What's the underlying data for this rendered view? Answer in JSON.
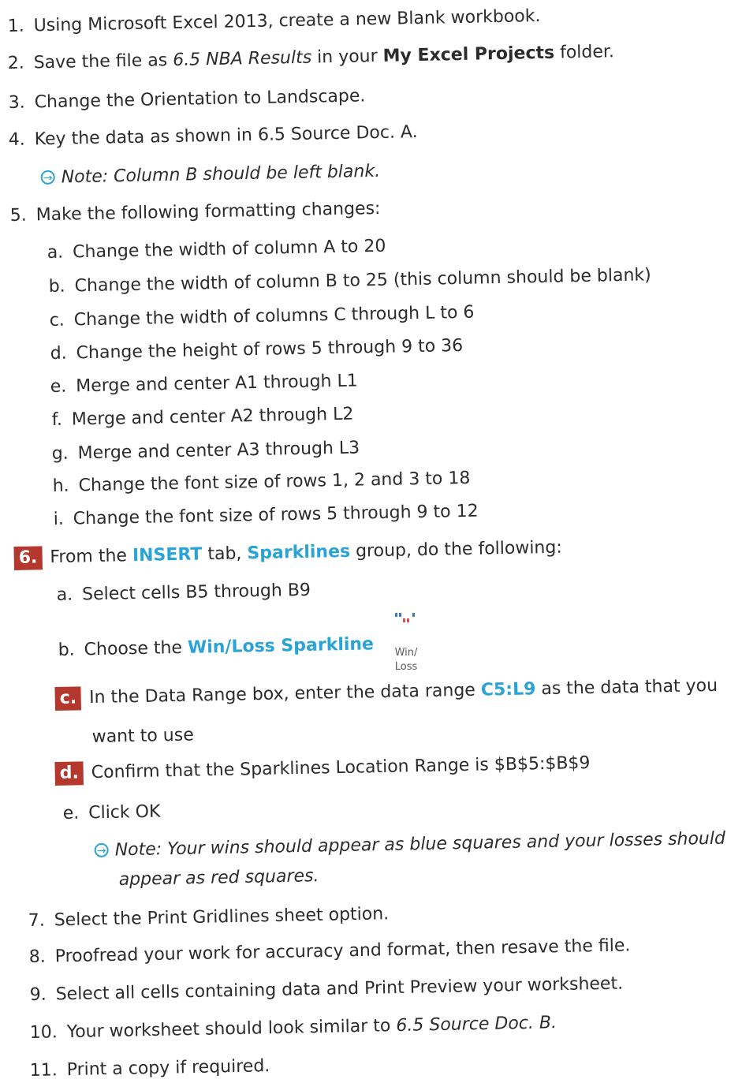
{
  "steps": [
    {
      "num": "1.",
      "text": "Using Microsoft Excel 2013, create a new Blank workbook."
    },
    {
      "num": "2.",
      "pre": "Save the file as ",
      "italic": "6.5 NBA Results",
      "mid": " in your ",
      "bold": "My Excel Projects",
      "post": " folder."
    },
    {
      "num": "3.",
      "text": "Change the Orientation to Landscape."
    },
    {
      "num": "4.",
      "text": "Key the data as shown in 6.5 Source Doc. A."
    },
    {
      "note": "Note: Column B should be left blank."
    },
    {
      "num": "5.",
      "text": "Make the following formatting changes:"
    },
    {
      "num": "a.",
      "text": "Change the width of column A to 20"
    },
    {
      "num": "b.",
      "text": "Change the width of column B to 25 (this column should be blank)"
    },
    {
      "num": "c.",
      "text": "Change the width of columns C through L to 6"
    },
    {
      "num": "d.",
      "text": "Change the height of rows 5 through 9 to 36"
    },
    {
      "num": "e.",
      "text": "Merge and center A1 through L1"
    },
    {
      "num": "f.",
      "text": "Merge and center A2 through L2"
    },
    {
      "num": "g.",
      "text": "Merge and center A3 through L3"
    },
    {
      "num": "h.",
      "text": "Change the font size of rows 1, 2 and 3 to 18"
    },
    {
      "num": "i.",
      "text": "Change the font size of rows 5 through 9 to 12"
    },
    {
      "num": "6.",
      "pre": "From the ",
      "blue1": "INSERT",
      "mid": " tab, ",
      "blue2": "Sparklines",
      "post": " group, do the following:"
    },
    {
      "num": "a.",
      "text": "Select cells B5 through B9"
    },
    {
      "num": "b.",
      "pre": "Choose the ",
      "blue1": "Win/Loss Sparkline"
    },
    {
      "num": "c.",
      "pre": "In the Data Range box, enter the data range ",
      "blue1": "C5:L9",
      "post": " as the data that you"
    },
    {
      "text": "want to use"
    },
    {
      "num": "d.",
      "text": "Confirm that the Sparklines Location Range is $B$5:$B$9"
    },
    {
      "num": "e.",
      "text": "Click OK"
    },
    {
      "note": "Note: Your wins should appear as blue squares and your losses should"
    },
    {
      "note": "appear as red squares."
    },
    {
      "num": "7.",
      "text": "Select the Print Gridlines sheet option."
    },
    {
      "num": "8.",
      "text": "Proofread your work for accuracy and format, then resave the file."
    },
    {
      "num": "9.",
      "text": "Select all cells containing data and Print Preview your worksheet."
    },
    {
      "num": "10.",
      "pre": "Your worksheet should look similar to ",
      "italic": "6.5 Source Doc. B."
    },
    {
      "num": "11.",
      "text": "Print a copy if required."
    }
  ],
  "winloss_icon": {
    "label_line1": "Win/",
    "label_line2": "Loss",
    "win_color": "#3b7dc4",
    "loss_color": "#d9534f"
  },
  "colors": {
    "accent_blue": "#2aa3d6",
    "badge_red": "#b5382f",
    "text": "#2c2c2c"
  }
}
